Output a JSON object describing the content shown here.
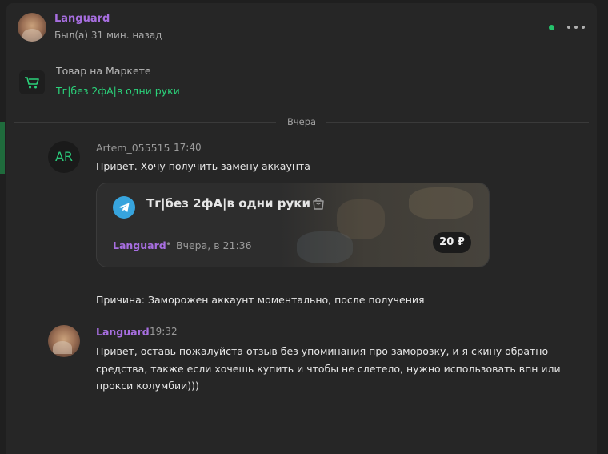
{
  "header": {
    "name": "Languard",
    "status": "Был(а) 31 мин. назад"
  },
  "product": {
    "caption": "Товар на Маркете",
    "link": "Тг|без 2фА|в одни руки"
  },
  "divider": {
    "label": "Вчера"
  },
  "messages": [
    {
      "author": "Artem_055515",
      "avatar_initials": "AR",
      "time": "17:40",
      "text": "Привет. Хочу получить замену аккаунта",
      "card": {
        "title": "Тг|без 2фА|в одни руки",
        "seller": "Languard",
        "separator": "•",
        "date": "Вчера, в 21:36",
        "price": "20 ₽"
      },
      "reason": "Причина: Заморожен аккаунт моментально, после получения"
    },
    {
      "author": "Languard",
      "time": "19:32",
      "lines": [
        "Привет, оставь пожалуйста отзыв без упоминания про заморозку, и я скину обратно",
        "средства, также если хочешь купить и чтобы не слетело, нужно использовать впн или",
        "прокси колумбии)))"
      ]
    }
  ],
  "colors": {
    "accent_purple": "#a76ee0",
    "accent_green": "#2bd27a",
    "online": "#25c26b",
    "telegram": "#37a4dd"
  },
  "icons": [
    "more-icon",
    "cart-icon",
    "telegram-icon",
    "shopping-bag-icon"
  ]
}
